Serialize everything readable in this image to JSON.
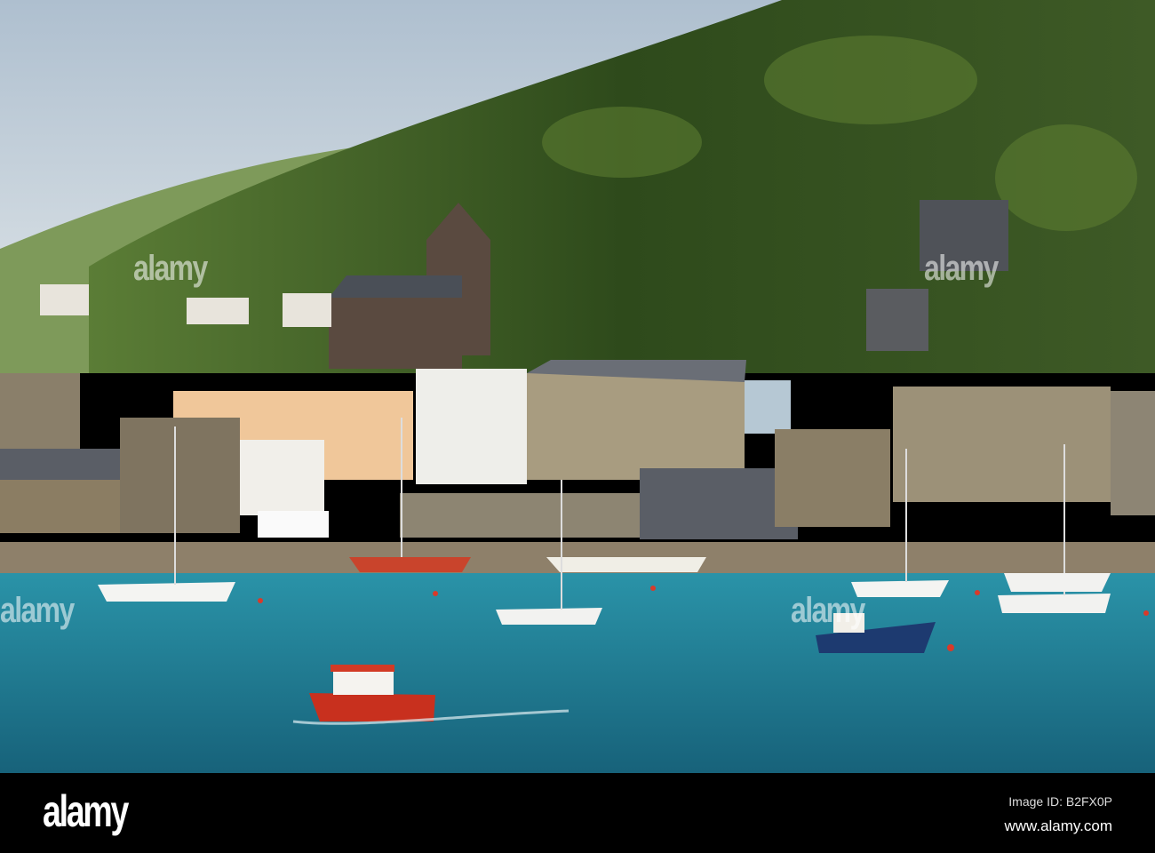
{
  "photo": {
    "subject": "harbour",
    "colors": {
      "sky": "#c9d6e0",
      "hill": "#2f4a1c",
      "hill_light": "#5f7f33",
      "water": "#1f7f96",
      "stone": "#8a7f6a",
      "roof": "#4a4f57"
    }
  },
  "watermark": {
    "text": "alamy"
  },
  "footer": {
    "logo": "alamy",
    "image_id": "Image ID: B2FX0P",
    "site": "www.alamy.com"
  }
}
